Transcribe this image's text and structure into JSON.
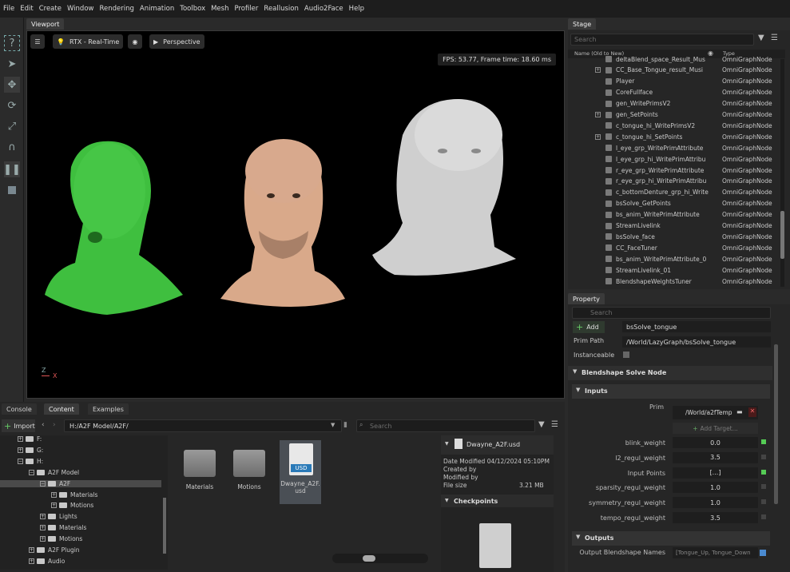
{
  "menu": [
    "File",
    "Edit",
    "Create",
    "Window",
    "Rendering",
    "Animation",
    "Toolbox",
    "Mesh",
    "Profiler",
    "Reallusion",
    "Audio2Face",
    "Help"
  ],
  "viewport": {
    "tab": "Viewport",
    "renderer": "RTX - Real-Time",
    "camera": "Perspective",
    "fps": "FPS: 53.77, Frame time: 18.60 ms",
    "axis_z": "Z",
    "axis_x": "X"
  },
  "stage": {
    "tab": "Stage",
    "search_placeholder": "Search",
    "col_name": "Name (Old to New)",
    "col_type": "Type",
    "rows": [
      {
        "name": "deltaBlend_space_Result_Mus",
        "type": "OmniGraphNode",
        "plus": false
      },
      {
        "name": "CC_Base_Tongue_result_Musi",
        "type": "OmniGraphNode",
        "plus": true
      },
      {
        "name": "Player",
        "type": "OmniGraphNode",
        "plus": false
      },
      {
        "name": "CoreFullface",
        "type": "OmniGraphNode",
        "plus": false
      },
      {
        "name": "gen_WritePrimsV2",
        "type": "OmniGraphNode",
        "plus": false
      },
      {
        "name": "gen_SetPoints",
        "type": "OmniGraphNode",
        "plus": true
      },
      {
        "name": "c_tongue_hi_WritePrimsV2",
        "type": "OmniGraphNode",
        "plus": false
      },
      {
        "name": "c_tongue_hi_SetPoints",
        "type": "OmniGraphNode",
        "plus": true
      },
      {
        "name": "l_eye_grp_WritePrimAttribute",
        "type": "OmniGraphNode",
        "plus": false
      },
      {
        "name": "l_eye_grp_hi_WritePrimAttribu",
        "type": "OmniGraphNode",
        "plus": false
      },
      {
        "name": "r_eye_grp_WritePrimAttribute",
        "type": "OmniGraphNode",
        "plus": false
      },
      {
        "name": "r_eye_grp_hi_WritePrimAttribu",
        "type": "OmniGraphNode",
        "plus": false
      },
      {
        "name": "c_bottomDenture_grp_hi_Write",
        "type": "OmniGraphNode",
        "plus": false
      },
      {
        "name": "bsSolve_GetPoints",
        "type": "OmniGraphNode",
        "plus": false
      },
      {
        "name": "bs_anim_WritePrimAttribute",
        "type": "OmniGraphNode",
        "plus": false
      },
      {
        "name": "StreamLivelink",
        "type": "OmniGraphNode",
        "plus": false
      },
      {
        "name": "bsSolve_face",
        "type": "OmniGraphNode",
        "plus": false
      },
      {
        "name": "CC_FaceTuner",
        "type": "OmniGraphNode",
        "plus": false
      },
      {
        "name": "bs_anim_WritePrimAttribute_0",
        "type": "OmniGraphNode",
        "plus": false
      },
      {
        "name": "StreamLivelink_01",
        "type": "OmniGraphNode",
        "plus": false
      },
      {
        "name": "BlendshapeWeightsTuner",
        "type": "OmniGraphNode",
        "plus": false
      }
    ]
  },
  "property": {
    "tab": "Property",
    "search_placeholder": "Search",
    "add_label": "Add",
    "name_value": "bsSolve_tongue",
    "prim_path_label": "Prim Path",
    "prim_path_value": "/World/LazyGraph/bsSolve_tongue",
    "instanceable_label": "Instanceable",
    "section_node": "Blendshape Solve Node",
    "section_inputs": "Inputs",
    "prim_label": "Prim",
    "prim_value": "/World/a2fTemp",
    "add_target": "Add Target...",
    "fields": [
      {
        "label": "blink_weight",
        "value": "0.0"
      },
      {
        "label": "l2_regul_weight",
        "value": "3.5"
      },
      {
        "label": "Input Points",
        "value": "[...]"
      },
      {
        "label": "sparsity_regul_weight",
        "value": "1.0"
      },
      {
        "label": "symmetry_regul_weight",
        "value": "1.0"
      },
      {
        "label": "tempo_regul_weight",
        "value": "3.5"
      }
    ],
    "section_outputs": "Outputs",
    "output_label": "Output Blendshape Names",
    "output_value": "[Tongue_Up, Tongue_Down"
  },
  "bottom": {
    "tabs": [
      "Console",
      "Content",
      "Examples"
    ],
    "import_label": "Import",
    "path": "H:/A2F Model/A2F/",
    "search_placeholder": "Search",
    "tree": [
      {
        "label": "F:",
        "indent": 1
      },
      {
        "label": "G:",
        "indent": 1
      },
      {
        "label": "H:",
        "indent": 1
      },
      {
        "label": "A2F Model",
        "indent": 2
      },
      {
        "label": "A2F",
        "indent": 3
      },
      {
        "label": "Materials",
        "indent": 4
      },
      {
        "label": "Motions",
        "indent": 4
      },
      {
        "label": "Lights",
        "indent": 3
      },
      {
        "label": "Materials",
        "indent": 3
      },
      {
        "label": "Motions",
        "indent": 3
      },
      {
        "label": "A2F Plugin",
        "indent": 2
      },
      {
        "label": "Audio",
        "indent": 2
      }
    ],
    "files": [
      {
        "name": "Materials",
        "kind": "folder"
      },
      {
        "name": "Motions",
        "kind": "folder"
      },
      {
        "name": "Dwayne_A2F.usd",
        "kind": "usd"
      }
    ],
    "usd_badge": "USD",
    "detail": {
      "filename": "Dwayne_A2F.usd",
      "date_modified": "Date Modified 04/12/2024 05:10PM",
      "created_by": "Created by",
      "modified_by": "Modified by",
      "file_size_label": "File size",
      "file_size_value": "3.21 MB",
      "checkpoints": "Checkpoints"
    }
  }
}
